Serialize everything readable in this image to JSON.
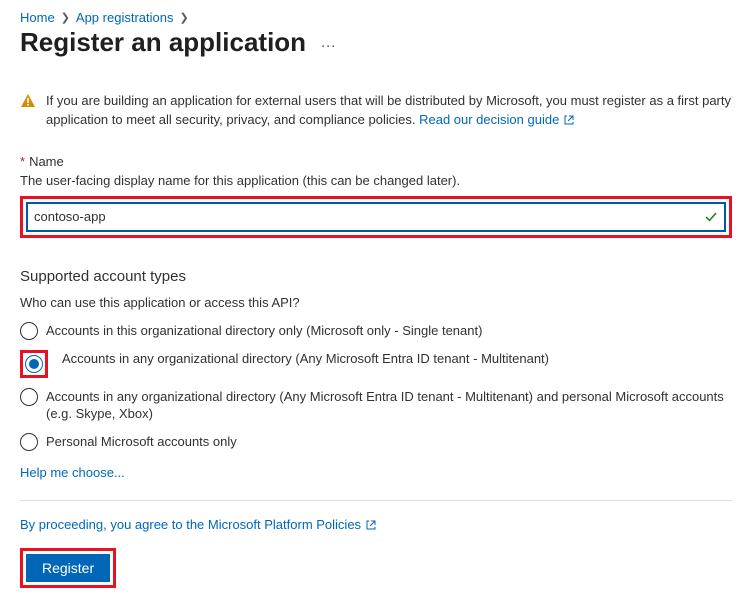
{
  "breadcrumb": {
    "home": "Home",
    "app_reg": "App registrations"
  },
  "title": "Register an application",
  "banner": {
    "text_pre": "If you are building an application for external users that will be distributed by Microsoft, you must register as a first party application to meet all security, privacy, and compliance policies. ",
    "link": "Read our decision guide"
  },
  "name_section": {
    "label": "Name",
    "help": "The user-facing display name for this application (this can be changed later).",
    "value": "contoso-app"
  },
  "account_types": {
    "heading": "Supported account types",
    "question": "Who can use this application or access this API?",
    "options": [
      "Accounts in this organizational directory only (Microsoft only - Single tenant)",
      "Accounts in any organizational directory (Any Microsoft Entra ID tenant - Multitenant)",
      "Accounts in any organizational directory (Any Microsoft Entra ID tenant - Multitenant) and personal Microsoft accounts (e.g. Skype, Xbox)",
      "Personal Microsoft accounts only"
    ],
    "selected_index": 1,
    "help_link": "Help me choose..."
  },
  "footer": {
    "policy_text": "By proceeding, you agree to the Microsoft Platform Policies",
    "register": "Register"
  }
}
